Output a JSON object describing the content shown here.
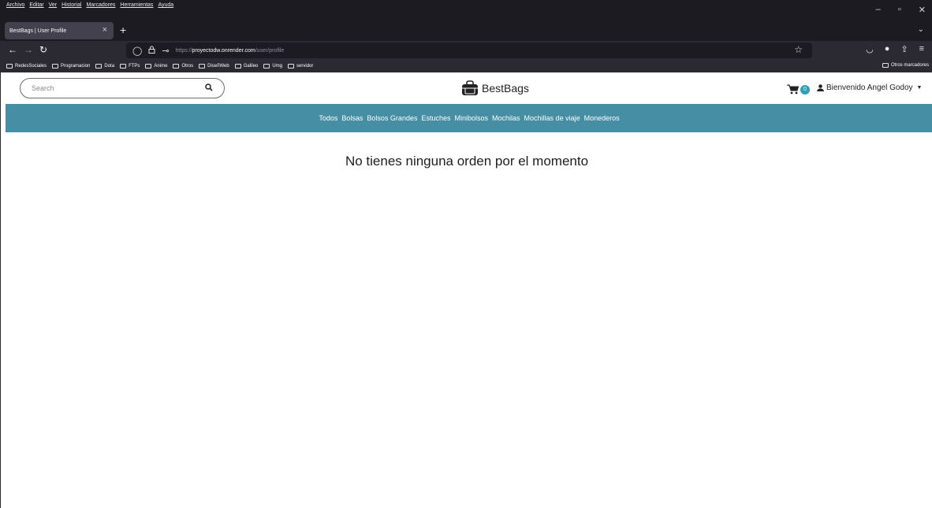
{
  "browser": {
    "menu": [
      "Archivo",
      "Editar",
      "Ver",
      "Historial",
      "Marcadores",
      "Herramientas",
      "Ayuda"
    ],
    "tab_title": "BestBags | User Profile",
    "url_scheme": "https://",
    "url_host": "proyectodw.onrender.com",
    "url_path": "/user/profile",
    "bookmarks": [
      "RedesSociales",
      "Programacion",
      "Dota",
      "FTPs",
      "Anime",
      "Otros",
      "DiseñWeb",
      "Galileo",
      "Umg",
      "servidor"
    ],
    "other_bookmarks": "Otros marcadores"
  },
  "site": {
    "search_placeholder": "Search",
    "brand": "BestBags",
    "cart_count": "0",
    "user_greeting": "Bienvenido Angel Godoy",
    "categories": [
      "Todos",
      "Bolsas",
      "Bolsos Grandes",
      "Estuches",
      "Minibolsos",
      "Mochilas",
      "Mochillas de viaje",
      "Monederos"
    ],
    "empty_message": "No tienes ninguna orden por el momento"
  },
  "colors": {
    "category_bar": "#458ea3",
    "badge": "#2e9fb4"
  }
}
